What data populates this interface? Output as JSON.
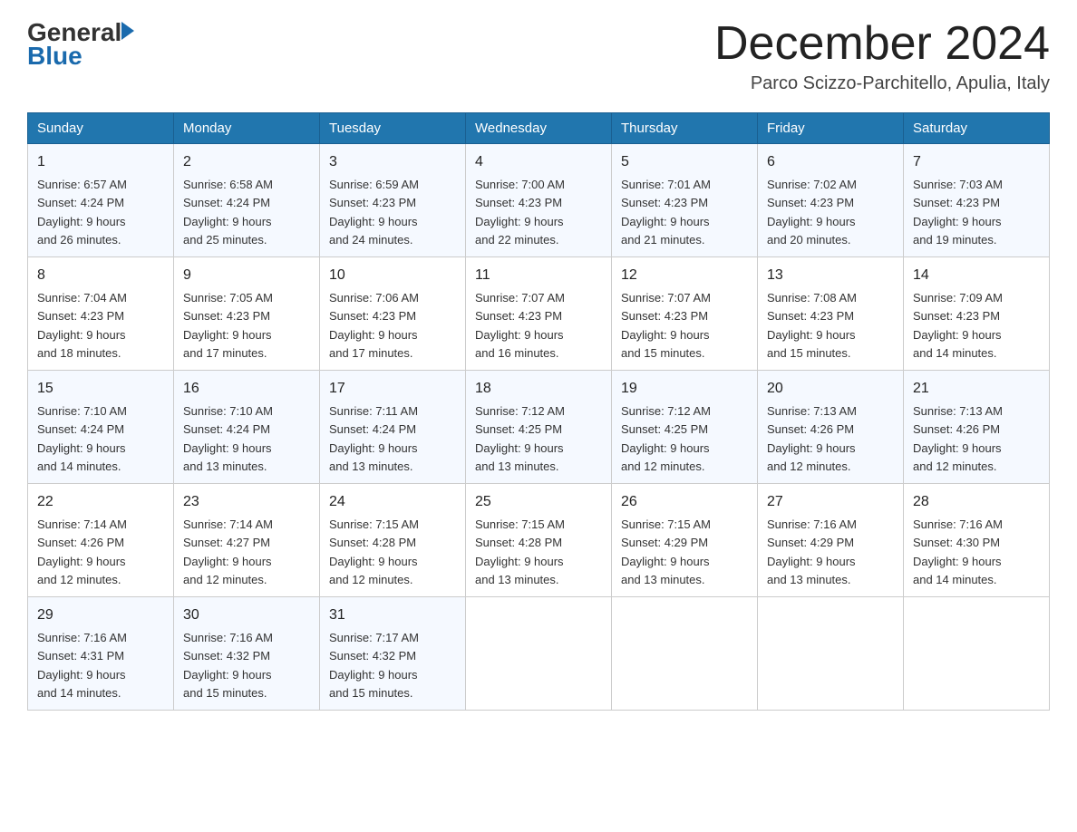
{
  "header": {
    "logo": {
      "general": "General",
      "blue": "Blue"
    },
    "title": "December 2024",
    "location": "Parco Scizzo-Parchitello, Apulia, Italy"
  },
  "days_of_week": [
    "Sunday",
    "Monday",
    "Tuesday",
    "Wednesday",
    "Thursday",
    "Friday",
    "Saturday"
  ],
  "weeks": [
    [
      {
        "day": "1",
        "sunrise": "6:57 AM",
        "sunset": "4:24 PM",
        "daylight": "9 hours and 26 minutes."
      },
      {
        "day": "2",
        "sunrise": "6:58 AM",
        "sunset": "4:24 PM",
        "daylight": "9 hours and 25 minutes."
      },
      {
        "day": "3",
        "sunrise": "6:59 AM",
        "sunset": "4:23 PM",
        "daylight": "9 hours and 24 minutes."
      },
      {
        "day": "4",
        "sunrise": "7:00 AM",
        "sunset": "4:23 PM",
        "daylight": "9 hours and 22 minutes."
      },
      {
        "day": "5",
        "sunrise": "7:01 AM",
        "sunset": "4:23 PM",
        "daylight": "9 hours and 21 minutes."
      },
      {
        "day": "6",
        "sunrise": "7:02 AM",
        "sunset": "4:23 PM",
        "daylight": "9 hours and 20 minutes."
      },
      {
        "day": "7",
        "sunrise": "7:03 AM",
        "sunset": "4:23 PM",
        "daylight": "9 hours and 19 minutes."
      }
    ],
    [
      {
        "day": "8",
        "sunrise": "7:04 AM",
        "sunset": "4:23 PM",
        "daylight": "9 hours and 18 minutes."
      },
      {
        "day": "9",
        "sunrise": "7:05 AM",
        "sunset": "4:23 PM",
        "daylight": "9 hours and 17 minutes."
      },
      {
        "day": "10",
        "sunrise": "7:06 AM",
        "sunset": "4:23 PM",
        "daylight": "9 hours and 17 minutes."
      },
      {
        "day": "11",
        "sunrise": "7:07 AM",
        "sunset": "4:23 PM",
        "daylight": "9 hours and 16 minutes."
      },
      {
        "day": "12",
        "sunrise": "7:07 AM",
        "sunset": "4:23 PM",
        "daylight": "9 hours and 15 minutes."
      },
      {
        "day": "13",
        "sunrise": "7:08 AM",
        "sunset": "4:23 PM",
        "daylight": "9 hours and 15 minutes."
      },
      {
        "day": "14",
        "sunrise": "7:09 AM",
        "sunset": "4:23 PM",
        "daylight": "9 hours and 14 minutes."
      }
    ],
    [
      {
        "day": "15",
        "sunrise": "7:10 AM",
        "sunset": "4:24 PM",
        "daylight": "9 hours and 14 minutes."
      },
      {
        "day": "16",
        "sunrise": "7:10 AM",
        "sunset": "4:24 PM",
        "daylight": "9 hours and 13 minutes."
      },
      {
        "day": "17",
        "sunrise": "7:11 AM",
        "sunset": "4:24 PM",
        "daylight": "9 hours and 13 minutes."
      },
      {
        "day": "18",
        "sunrise": "7:12 AM",
        "sunset": "4:25 PM",
        "daylight": "9 hours and 13 minutes."
      },
      {
        "day": "19",
        "sunrise": "7:12 AM",
        "sunset": "4:25 PM",
        "daylight": "9 hours and 12 minutes."
      },
      {
        "day": "20",
        "sunrise": "7:13 AM",
        "sunset": "4:26 PM",
        "daylight": "9 hours and 12 minutes."
      },
      {
        "day": "21",
        "sunrise": "7:13 AM",
        "sunset": "4:26 PM",
        "daylight": "9 hours and 12 minutes."
      }
    ],
    [
      {
        "day": "22",
        "sunrise": "7:14 AM",
        "sunset": "4:26 PM",
        "daylight": "9 hours and 12 minutes."
      },
      {
        "day": "23",
        "sunrise": "7:14 AM",
        "sunset": "4:27 PM",
        "daylight": "9 hours and 12 minutes."
      },
      {
        "day": "24",
        "sunrise": "7:15 AM",
        "sunset": "4:28 PM",
        "daylight": "9 hours and 12 minutes."
      },
      {
        "day": "25",
        "sunrise": "7:15 AM",
        "sunset": "4:28 PM",
        "daylight": "9 hours and 13 minutes."
      },
      {
        "day": "26",
        "sunrise": "7:15 AM",
        "sunset": "4:29 PM",
        "daylight": "9 hours and 13 minutes."
      },
      {
        "day": "27",
        "sunrise": "7:16 AM",
        "sunset": "4:29 PM",
        "daylight": "9 hours and 13 minutes."
      },
      {
        "day": "28",
        "sunrise": "7:16 AM",
        "sunset": "4:30 PM",
        "daylight": "9 hours and 14 minutes."
      }
    ],
    [
      {
        "day": "29",
        "sunrise": "7:16 AM",
        "sunset": "4:31 PM",
        "daylight": "9 hours and 14 minutes."
      },
      {
        "day": "30",
        "sunrise": "7:16 AM",
        "sunset": "4:32 PM",
        "daylight": "9 hours and 15 minutes."
      },
      {
        "day": "31",
        "sunrise": "7:17 AM",
        "sunset": "4:32 PM",
        "daylight": "9 hours and 15 minutes."
      },
      null,
      null,
      null,
      null
    ]
  ]
}
